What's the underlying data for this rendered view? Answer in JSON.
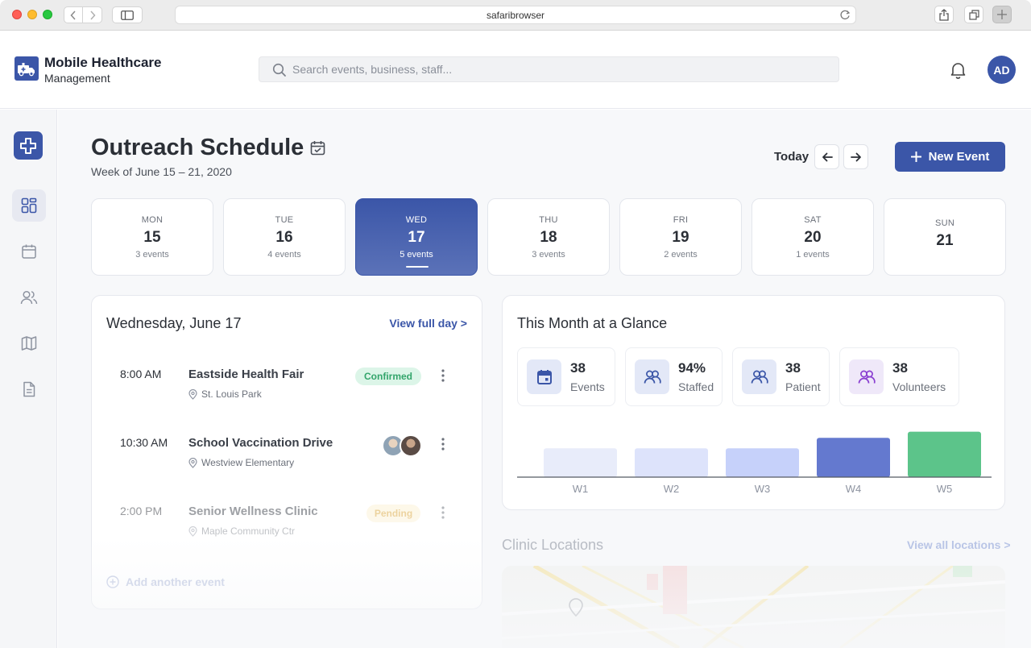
{
  "browser": {
    "url": "safaribrowser"
  },
  "app": {
    "brand_title": "Mobile Healthcare",
    "brand_subtitle": "Management",
    "search_placeholder": "Search events, business, staff...",
    "user_initials": "AD",
    "accent_color": "#3b56a8"
  },
  "sidebar": {
    "items": [
      {
        "name": "dashboard",
        "icon": "dashboard-icon",
        "active": true
      },
      {
        "name": "calendar",
        "icon": "calendar-icon",
        "active": false
      },
      {
        "name": "staff",
        "icon": "users-icon",
        "active": false
      },
      {
        "name": "map",
        "icon": "map-icon",
        "active": false
      },
      {
        "name": "documents",
        "icon": "document-icon",
        "active": false
      }
    ]
  },
  "header": {
    "title": "Outreach Schedule",
    "subtitle": "Week of June 15 – 21, 2020",
    "today_label": "Today",
    "new_event_label": "New Event"
  },
  "days": [
    {
      "name": "MON",
      "num": "15",
      "count": "3 events"
    },
    {
      "name": "TUE",
      "num": "16",
      "count": "4 events"
    },
    {
      "name": "WED",
      "num": "17",
      "count": "5 events",
      "active": true
    },
    {
      "name": "THU",
      "num": "18",
      "count": "3 events"
    },
    {
      "name": "FRI",
      "num": "19",
      "count": "2 events"
    },
    {
      "name": "SAT",
      "num": "20",
      "count": "1 events"
    },
    {
      "name": "SUN",
      "num": "21",
      "count": ""
    }
  ],
  "agenda": {
    "title": "Wednesday, June 17",
    "view_link": "View full day >",
    "events": [
      {
        "time": "8:00 AM",
        "name": "Eastside Health Fair",
        "location": "St. Louis Park",
        "status": "Confirmed"
      },
      {
        "time": "10:30 AM",
        "name": "School Vaccination Drive",
        "location": "Westview Elementary",
        "status": ""
      },
      {
        "time": "2:00 PM",
        "name": "Senior Wellness Clinic",
        "location": "Maple Community Ctr",
        "status": "Pending"
      }
    ],
    "add_label": "Add another event"
  },
  "glance": {
    "title": "This Month at a Glance",
    "stats": [
      {
        "value": "38",
        "label": "Events",
        "icon": "calendar-icon"
      },
      {
        "value": "94%",
        "label": "Staffed",
        "icon": "users-icon"
      },
      {
        "value": "38",
        "label": "Patient",
        "icon": "users-icon"
      },
      {
        "value": "38",
        "label": "Volunteers",
        "icon": "users-icon"
      }
    ]
  },
  "chart_data": {
    "type": "bar",
    "categories": [
      "W1",
      "W2",
      "W3",
      "W4",
      "W5"
    ],
    "values": [
      33,
      33,
      33,
      45,
      52
    ],
    "colors": [
      "#e8ecfa",
      "#dde3fb",
      "#c6d1fa",
      "#6479cf",
      "#5cc48a"
    ],
    "ylim": [
      0,
      60
    ],
    "title": "",
    "xlabel": "",
    "ylabel": "",
    "grid": false
  },
  "clinics": {
    "title": "Clinic Locations",
    "link": "View all locations >"
  }
}
